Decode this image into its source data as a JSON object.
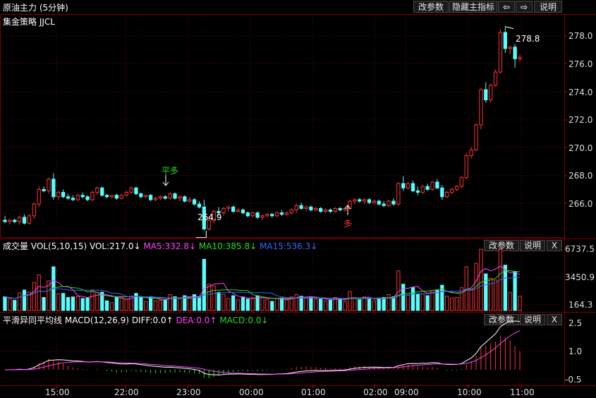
{
  "header": {
    "title": "原油主力 (5分钟)",
    "btn_params": "改参数",
    "btn_hide": "隐藏主指标",
    "btn_left": "⇦",
    "btn_right": "⇨",
    "btn_help": "说明"
  },
  "main": {
    "indicator_name": "集金策略 JJCL",
    "high_label": "278.8",
    "low_label": "264.9",
    "signal_ping": "平多",
    "signal_duo": "多",
    "y_ticks": [
      "278.0",
      "276.0",
      "274.0",
      "272.0",
      "270.0",
      "268.0",
      "266.0"
    ]
  },
  "volume": {
    "name": "成交量",
    "vol_params": "VOL(5,10,15)",
    "vol_value": "VOL:217.0↓",
    "ma5": "MA5:332.8↓",
    "ma10": "MA10:385.8↓",
    "ma15": "MA15:536.3↓",
    "btn_params": "改参数",
    "btn_help": "说明",
    "btn_close": "X",
    "y_ticks": [
      "6737.5",
      "3450.9",
      "164.3"
    ]
  },
  "macd": {
    "name": "平滑异同平均线",
    "params": "MACD(12,26,9)",
    "diff": "DIFF:0.0↑",
    "dea": "DEA:0.0↑",
    "macd_val": "MACD:0.0↓",
    "btn_params": "改参数",
    "btn_help": "说明",
    "btn_close": "X",
    "y_ticks": [
      "2.5",
      "1.0",
      "-0.5"
    ]
  },
  "x_ticks": [
    "15:00",
    "22:00",
    "23:00",
    "00:00",
    "01:00",
    "02:00",
    "09:00",
    "10:00",
    "11:00"
  ],
  "colors": {
    "up": "#ff3232",
    "down": "#54ffff",
    "ma5": "#ff44ff",
    "ma10": "#22dd22",
    "ma15": "#3366ff",
    "grid": "#7a0000",
    "diff": "#ffffff",
    "dea": "#ff44ff"
  },
  "chart_data": {
    "type": "candlestick",
    "title": "原油主力 (5分钟)",
    "price_ylim": [
      264.4,
      279.6
    ],
    "candles_ohlc": [
      [
        265.6,
        265.9,
        265.4,
        265.5
      ],
      [
        265.5,
        265.7,
        265.3,
        265.6
      ],
      [
        265.6,
        265.7,
        265.4,
        265.5
      ],
      [
        265.5,
        265.9,
        265.3,
        265.8
      ],
      [
        265.8,
        266.0,
        265.3,
        265.4
      ],
      [
        265.4,
        266.0,
        265.3,
        265.9
      ],
      [
        265.9,
        266.8,
        265.7,
        266.7
      ],
      [
        266.7,
        267.9,
        266.5,
        267.7
      ],
      [
        267.7,
        267.9,
        267.5,
        267.6
      ],
      [
        267.6,
        268.5,
        267.4,
        268.4
      ],
      [
        268.4,
        268.8,
        267.0,
        267.2
      ],
      [
        267.2,
        267.6,
        267.0,
        267.5
      ],
      [
        267.5,
        267.7,
        267.1,
        267.2
      ],
      [
        267.2,
        267.4,
        267.0,
        267.1
      ],
      [
        267.1,
        267.3,
        266.9,
        267.0
      ],
      [
        267.0,
        267.4,
        266.9,
        267.3
      ],
      [
        267.3,
        267.5,
        267.1,
        267.2
      ],
      [
        267.2,
        267.3,
        266.9,
        267.0
      ],
      [
        267.0,
        267.6,
        266.9,
        267.5
      ],
      [
        267.5,
        267.9,
        267.3,
        267.8
      ],
      [
        267.8,
        267.9,
        267.2,
        267.3
      ],
      [
        267.3,
        267.4,
        267.1,
        267.2
      ],
      [
        267.2,
        267.3,
        267.1,
        267.3
      ],
      [
        267.3,
        267.4,
        267.0,
        267.1
      ],
      [
        267.1,
        267.4,
        267.0,
        267.3
      ],
      [
        267.3,
        267.6,
        267.2,
        267.5
      ],
      [
        267.5,
        267.9,
        267.4,
        267.8
      ],
      [
        267.8,
        267.9,
        267.3,
        267.4
      ],
      [
        267.4,
        267.5,
        267.1,
        267.2
      ],
      [
        267.2,
        267.3,
        267.1,
        267.3
      ],
      [
        267.3,
        267.4,
        266.9,
        267.0
      ],
      [
        267.0,
        267.2,
        266.9,
        267.1
      ],
      [
        267.1,
        267.3,
        267.0,
        267.2
      ],
      [
        267.2,
        267.3,
        267.0,
        267.1
      ],
      [
        267.1,
        267.5,
        267.0,
        267.4
      ],
      [
        267.4,
        267.5,
        267.0,
        267.1
      ],
      [
        267.1,
        267.3,
        266.9,
        267.2
      ],
      [
        267.2,
        267.3,
        266.8,
        266.9
      ],
      [
        266.9,
        267.2,
        266.8,
        267.0
      ],
      [
        267.0,
        267.1,
        266.6,
        266.7
      ],
      [
        266.7,
        266.9,
        266.4,
        266.5
      ],
      [
        266.5,
        267.0,
        264.9,
        265.0
      ],
      [
        265.0,
        265.9,
        264.9,
        265.6
      ],
      [
        265.6,
        266.3,
        265.4,
        266.2
      ],
      [
        266.2,
        266.5,
        265.9,
        266.1
      ],
      [
        266.1,
        266.5,
        265.9,
        266.4
      ],
      [
        266.4,
        266.6,
        266.2,
        266.5
      ],
      [
        266.5,
        266.6,
        266.1,
        266.2
      ],
      [
        266.2,
        266.4,
        266.1,
        266.3
      ],
      [
        266.3,
        266.4,
        266.0,
        266.1
      ],
      [
        266.1,
        266.2,
        265.8,
        265.9
      ],
      [
        265.9,
        266.2,
        265.8,
        266.1
      ],
      [
        266.1,
        266.2,
        265.7,
        265.8
      ],
      [
        265.8,
        266.0,
        265.6,
        265.9
      ],
      [
        265.9,
        266.1,
        265.8,
        266.0
      ],
      [
        266.0,
        266.1,
        265.8,
        265.9
      ],
      [
        265.9,
        266.2,
        265.8,
        266.1
      ],
      [
        266.1,
        266.3,
        265.9,
        266.0
      ],
      [
        266.0,
        266.2,
        265.9,
        266.1
      ],
      [
        266.1,
        266.4,
        266.0,
        266.3
      ],
      [
        266.3,
        266.7,
        266.1,
        266.6
      ],
      [
        266.6,
        266.8,
        266.3,
        266.4
      ],
      [
        266.4,
        266.6,
        266.2,
        266.5
      ],
      [
        266.5,
        266.6,
        266.2,
        266.3
      ],
      [
        266.3,
        266.5,
        266.2,
        266.4
      ],
      [
        266.4,
        266.5,
        266.1,
        266.2
      ],
      [
        266.2,
        266.4,
        266.1,
        266.3
      ],
      [
        266.3,
        266.4,
        266.1,
        266.2
      ],
      [
        266.2,
        266.5,
        266.1,
        266.4
      ],
      [
        266.4,
        266.5,
        266.2,
        266.3
      ],
      [
        266.3,
        266.5,
        266.2,
        266.4
      ],
      [
        266.4,
        267.0,
        266.3,
        266.9
      ],
      [
        266.9,
        267.1,
        266.7,
        267.0
      ],
      [
        267.0,
        267.1,
        266.8,
        266.9
      ],
      [
        266.9,
        267.1,
        266.7,
        267.0
      ],
      [
        267.0,
        267.1,
        266.7,
        266.8
      ],
      [
        266.8,
        267.0,
        266.7,
        266.9
      ],
      [
        266.9,
        267.0,
        266.6,
        266.7
      ],
      [
        266.7,
        266.9,
        266.5,
        266.6
      ],
      [
        266.6,
        267.0,
        266.5,
        266.9
      ],
      [
        266.9,
        267.1,
        266.6,
        266.7
      ],
      [
        266.7,
        268.2,
        266.6,
        268.1
      ],
      [
        268.1,
        268.6,
        267.6,
        267.8
      ],
      [
        267.8,
        268.2,
        267.7,
        268.1
      ],
      [
        268.1,
        268.3,
        267.5,
        267.6
      ],
      [
        267.6,
        267.9,
        267.3,
        267.5
      ],
      [
        267.5,
        268.0,
        267.4,
        267.9
      ],
      [
        267.9,
        268.1,
        267.6,
        267.7
      ],
      [
        267.7,
        268.3,
        267.6,
        268.2
      ],
      [
        268.2,
        268.4,
        267.7,
        267.8
      ],
      [
        267.8,
        268.0,
        267.0,
        267.2
      ],
      [
        267.2,
        267.6,
        267.1,
        267.5
      ],
      [
        267.5,
        267.8,
        267.4,
        267.7
      ],
      [
        267.7,
        268.0,
        267.6,
        267.9
      ],
      [
        267.9,
        268.6,
        267.8,
        268.5
      ],
      [
        268.5,
        270.2,
        268.4,
        270.0
      ],
      [
        270.0,
        270.6,
        269.8,
        270.4
      ],
      [
        270.4,
        272.2,
        270.3,
        272.1
      ],
      [
        272.1,
        274.6,
        271.8,
        274.5
      ],
      [
        274.5,
        275.0,
        273.6,
        273.8
      ],
      [
        273.8,
        274.9,
        273.6,
        274.8
      ],
      [
        274.8,
        275.9,
        274.7,
        275.7
      ],
      [
        275.7,
        278.6,
        275.6,
        278.4
      ],
      [
        278.4,
        278.8,
        277.0,
        277.3
      ],
      [
        277.3,
        277.5,
        276.9,
        277.4
      ],
      [
        277.4,
        277.6,
        276.0,
        276.6
      ],
      [
        276.6,
        276.9,
        276.4,
        276.7
      ]
    ],
    "volume_ylim": [
      0,
      7000
    ],
    "macd_ylim": [
      -0.8,
      2.6
    ],
    "x_tick_labels": [
      "15:00",
      "22:00",
      "23:00",
      "00:00",
      "01:00",
      "02:00",
      "09:00",
      "10:00",
      "11:00"
    ]
  }
}
